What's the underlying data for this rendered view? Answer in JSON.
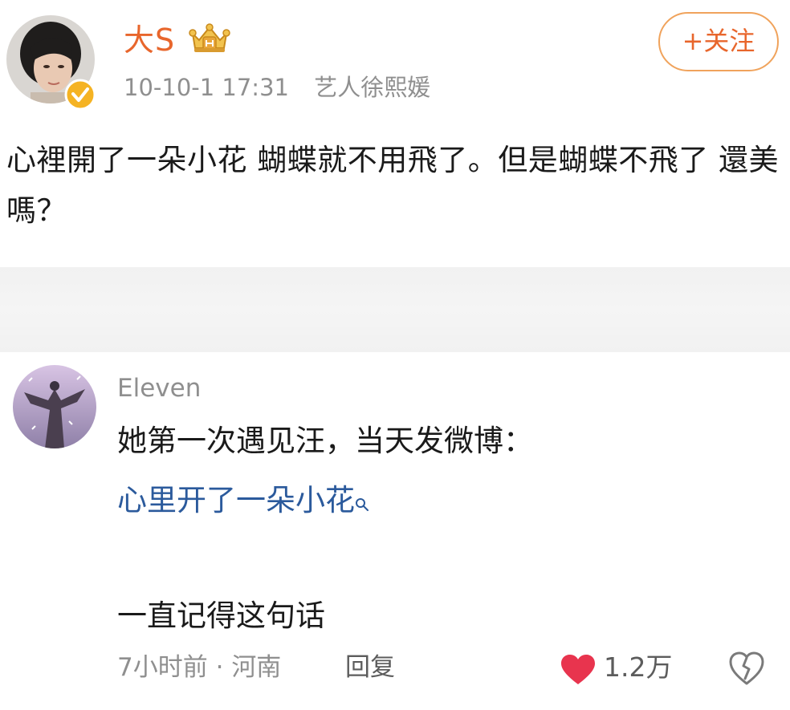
{
  "post": {
    "author": "大S",
    "author_badge": "crown-vip-icon",
    "timestamp": "10-10-1 17:31",
    "source": "艺人徐熙媛",
    "follow_label": "+关注",
    "text": "心裡開了一朵小花 蝴蝶就不用飛了。但是蝴蝶不飛了 還美嗎？"
  },
  "comment": {
    "author": "Eleven",
    "line1": "她第一次遇见汪，当天发微博：",
    "link_text": "心里开了一朵小花",
    "line3": "一直记得这句话",
    "time": "7小时前",
    "separator": "·",
    "location": "河南",
    "reply_label": "回复",
    "like_count": "1.2万"
  },
  "colors": {
    "accent_orange": "#e8662c",
    "follow_border": "#f0a35c",
    "link_blue": "#2b5a9c",
    "like_red": "#e8344e",
    "meta_gray": "#8f8f8f",
    "verify_gold": "#f5b323"
  }
}
